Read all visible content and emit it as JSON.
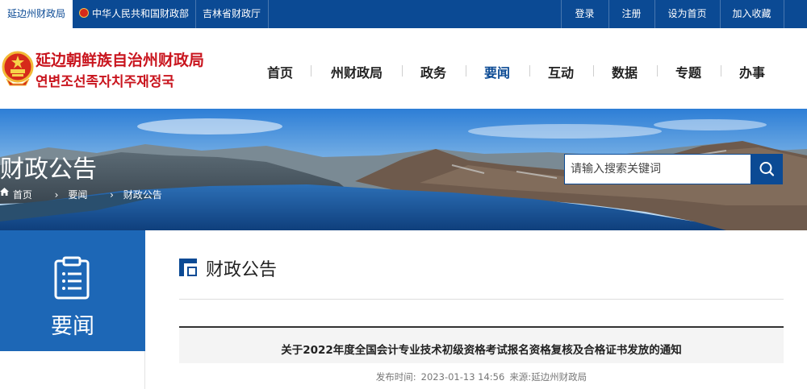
{
  "topbar": {
    "tabs": [
      {
        "label": "延边州财政局"
      },
      {
        "label": "中华人民共和国财政部"
      },
      {
        "label": "吉林省财政厅"
      }
    ],
    "links": [
      {
        "label": "登录"
      },
      {
        "label": "注册"
      },
      {
        "label": "设为首页"
      },
      {
        "label": "加入收藏"
      }
    ]
  },
  "logo": {
    "name_cn": "延边朝鲜族自治州财政局",
    "name_kr": "연변조선족자치주재정국"
  },
  "nav": {
    "items": [
      {
        "label": "首页"
      },
      {
        "label": "州财政局"
      },
      {
        "label": "政务"
      },
      {
        "label": "要闻"
      },
      {
        "label": "互动"
      },
      {
        "label": "数据"
      },
      {
        "label": "专题"
      },
      {
        "label": "办事"
      }
    ],
    "active_index": 3
  },
  "banner": {
    "title": "财政公告",
    "breadcrumb": [
      "首页",
      "要闻",
      "财政公告"
    ],
    "search_placeholder": "请输入搜索关键词"
  },
  "sidebar": {
    "title": "要闻"
  },
  "content": {
    "section_title": "财政公告",
    "article": {
      "title": "关于2022年度全国会计专业技术初级资格考试报名资格复核及合格证书发放的通知",
      "meta_label": "发布时间:",
      "date": "2023-01-13 14:56",
      "source_label": "来源:",
      "source": "延边州财政局"
    }
  },
  "colors": {
    "brand_blue": "#0b4a94",
    "sidebar_blue": "#1d67b6",
    "logo_red": "#c9151e"
  },
  "icons": {
    "search": "magnifier-icon",
    "home": "home-icon",
    "sidebar": "clipboard-list-icon",
    "breadcrumb_sep": "chevron-right-icon"
  }
}
